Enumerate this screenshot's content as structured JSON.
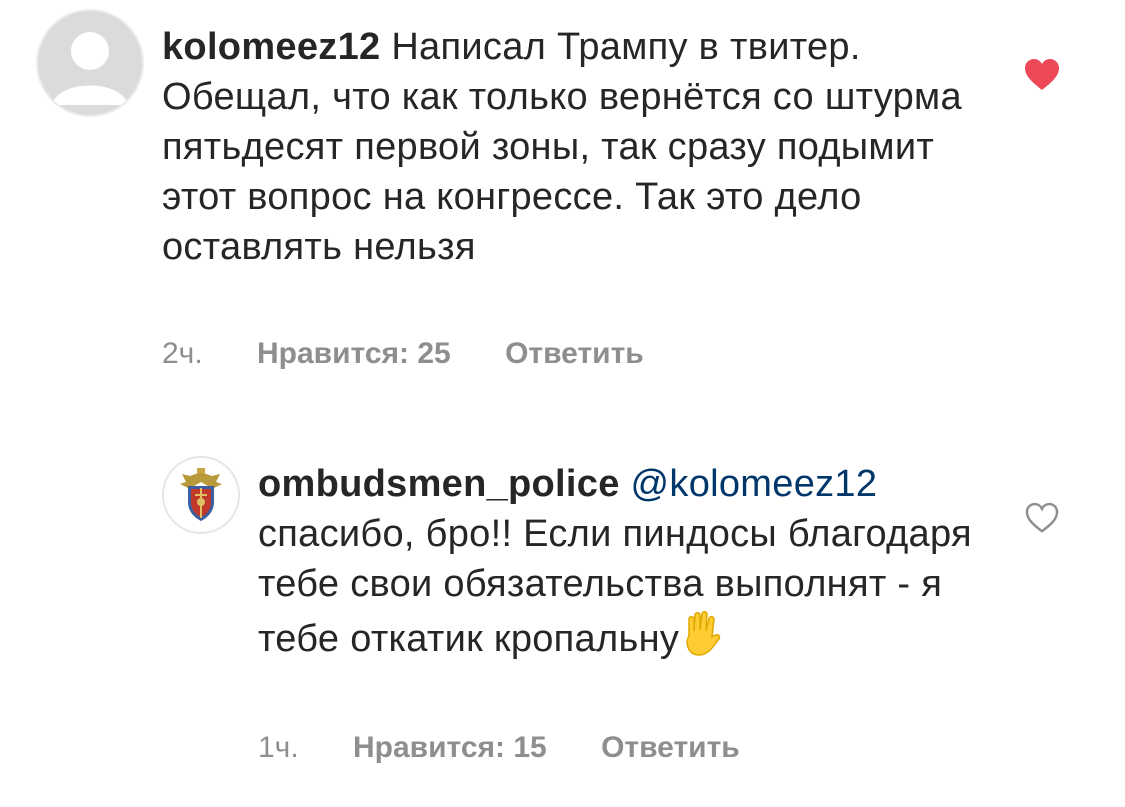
{
  "comments": [
    {
      "username": "kolomeez12",
      "text": "Написал Трампу в твитер. Обещал, что как только вернётся со штурма пятьдесят первой зоны, так сразу подымит этот вопрос на конгрессе. Так это дело оставлять нельзя",
      "time": "2ч.",
      "likes_label": "Нравится: 25",
      "reply_label": "Ответить",
      "liked": true,
      "avatar_icon": "default-avatar-icon",
      "heart_icon": "heart-filled-icon",
      "heart_color": "#ed4956"
    },
    {
      "username": "ombudsmen_police",
      "mention": "@kolomeez12",
      "text": "спасибо, бро!! Если пиндосы благодаря тебе свои обязательства выполнят - я тебе откатик кропальну",
      "time": "1ч.",
      "likes_label": "Нравится: 15",
      "reply_label": "Ответить",
      "liked": false,
      "avatar_icon": "police-emblem-icon",
      "heart_icon": "heart-outline-icon",
      "emoji_icon": "raised-hand-emoji-icon"
    }
  ],
  "colors": {
    "text": "#262626",
    "meta": "#8e8e8e",
    "mention": "#00376b",
    "heart_liked": "#ed4956"
  }
}
